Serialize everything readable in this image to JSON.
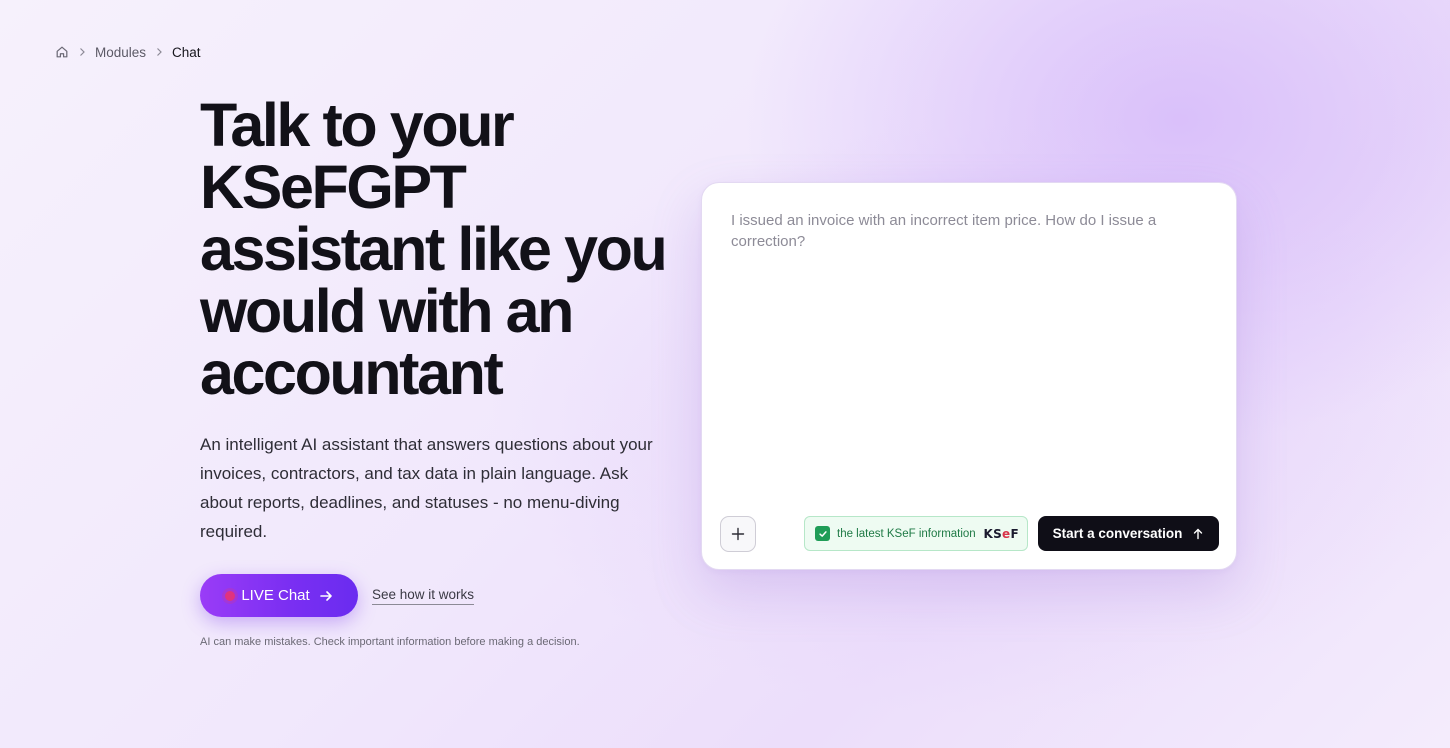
{
  "breadcrumb": {
    "home_icon": "home-icon",
    "separator_icon": "chevron-right-icon",
    "items": [
      "Modules",
      "Chat"
    ]
  },
  "hero": {
    "title": "Talk to your KSeFGPT assistant like you would with an accountant",
    "subtitle": "An intelligent AI assistant that answers questions about your invoices, contractors, and tax data in plain language. Ask about reports, deadlines, and statuses - no menu-diving required.",
    "live_button_label": "LIVE Chat",
    "see_link_label": "See how it works",
    "disclaimer": "AI can make mistakes. Check important information before making a decision."
  },
  "chat": {
    "input_value": "",
    "input_placeholder": "I issued an invoice with an incorrect item price. How do I issue a correction?",
    "add_icon": "plus-icon",
    "ksef_toggle": {
      "checked": true,
      "label": "the latest KSeF information",
      "logo_prefix": "KS",
      "logo_accent": "e",
      "logo_suffix": "F"
    },
    "start_button_label": "Start a conversation",
    "start_icon": "arrow-up-icon"
  },
  "colors": {
    "accent_purple": "#7b2ff2",
    "live_dot": "#e0337e",
    "ksef_green": "#1f9d57",
    "button_dark": "#0f0e17"
  }
}
